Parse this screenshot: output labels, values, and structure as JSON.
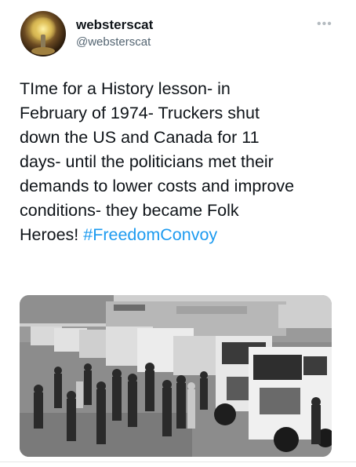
{
  "user": {
    "display_name": "websterscat",
    "handle": "@websterscat"
  },
  "menu_icon": "more-dots-icon",
  "tweet": {
    "text": "TIme for a History lesson- in\nFebruary of 1974- Truckers shut\ndown the US and Canada for 11\ndays- until the politicians met their\ndemands to lower costs and improve\nconditions- they became Folk\nHeroes! ",
    "hashtag": "#FreedomConvoy"
  },
  "media": {
    "type": "photo",
    "tone": "black-and-white"
  },
  "colors": {
    "hashtag": "#1d9bf0",
    "handle": "#536471"
  }
}
